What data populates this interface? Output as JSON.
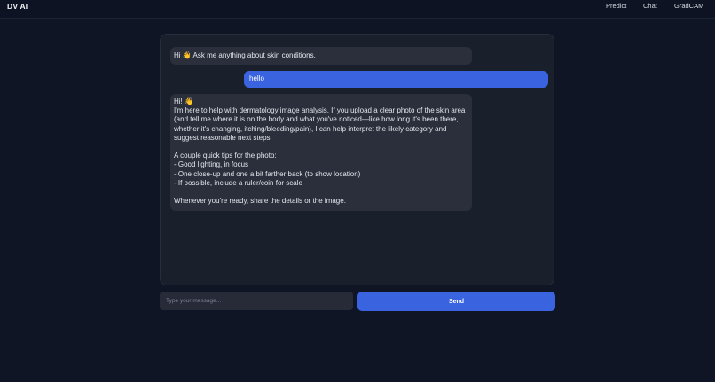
{
  "header": {
    "brand": "DV AI",
    "nav": [
      {
        "label": "Predict"
      },
      {
        "label": "Chat"
      },
      {
        "label": "GradCAM"
      }
    ]
  },
  "chat": {
    "messages": [
      {
        "role": "bot",
        "text": "Hi 👋 Ask me anything about skin conditions."
      },
      {
        "role": "user",
        "text": "hello"
      },
      {
        "role": "bot",
        "text": "Hi! 👋\nI'm here to help with dermatology image analysis. If you upload a clear photo of the skin area (and tell me where it is on the body and what you've noticed—like how long it's been there, whether it's changing, itching/bleeding/pain), I can help interpret the likely category and suggest reasonable next steps.\n\nA couple quick tips for the photo:\n- Good lighting, in focus\n- One close-up and one a bit farther back (to show location)\n- If possible, include a ruler/coin for scale\n\nWhenever you're ready, share the details or the image."
      }
    ]
  },
  "composer": {
    "placeholder": "Type your message...",
    "value": "",
    "send_label": "Send"
  },
  "colors": {
    "background": "#0f1525",
    "panel": "#1a1f2c",
    "bot_bubble": "#2a2f3b",
    "accent": "#3a63e0"
  }
}
